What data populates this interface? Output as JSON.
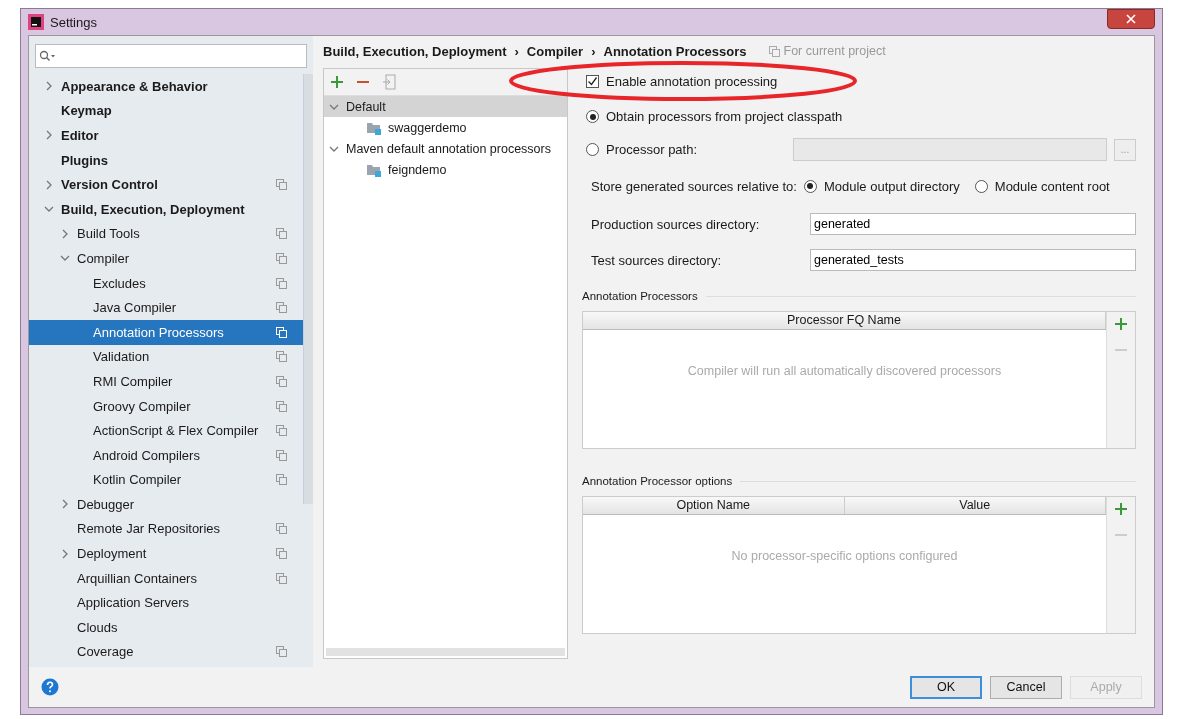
{
  "window": {
    "title": "Settings"
  },
  "sidebar": {
    "items": [
      {
        "label": "Appearance & Behavior",
        "kind": "collapsed",
        "project_icon": false,
        "selected": false
      },
      {
        "label": "Keymap",
        "kind": "leaf",
        "project_icon": false,
        "selected": false
      },
      {
        "label": "Editor",
        "kind": "collapsed",
        "project_icon": false,
        "selected": false
      },
      {
        "label": "Plugins",
        "kind": "leaf",
        "project_icon": false,
        "selected": false
      },
      {
        "label": "Version Control",
        "kind": "collapsed",
        "project_icon": true,
        "selected": false
      },
      {
        "label": "Build, Execution, Deployment",
        "kind": "expanded",
        "project_icon": false,
        "selected": false,
        "children": [
          {
            "label": "Build Tools",
            "kind": "collapsed",
            "project_icon": true,
            "selected": false
          },
          {
            "label": "Compiler",
            "kind": "expanded",
            "project_icon": true,
            "selected": false,
            "children": [
              {
                "label": "Excludes",
                "kind": "leaf",
                "project_icon": true,
                "selected": false
              },
              {
                "label": "Java Compiler",
                "kind": "leaf",
                "project_icon": true,
                "selected": false
              },
              {
                "label": "Annotation Processors",
                "kind": "leaf",
                "project_icon": true,
                "selected": true
              },
              {
                "label": "Validation",
                "kind": "leaf",
                "project_icon": true,
                "selected": false
              },
              {
                "label": "RMI Compiler",
                "kind": "leaf",
                "project_icon": true,
                "selected": false
              },
              {
                "label": "Groovy Compiler",
                "kind": "leaf",
                "project_icon": true,
                "selected": false
              },
              {
                "label": "ActionScript & Flex Compiler",
                "kind": "leaf",
                "project_icon": true,
                "selected": false
              },
              {
                "label": "Android Compilers",
                "kind": "leaf",
                "project_icon": true,
                "selected": false
              },
              {
                "label": "Kotlin Compiler",
                "kind": "leaf",
                "project_icon": true,
                "selected": false
              }
            ]
          },
          {
            "label": "Debugger",
            "kind": "collapsed",
            "project_icon": false,
            "selected": false
          },
          {
            "label": "Remote Jar Repositories",
            "kind": "leaf",
            "project_icon": true,
            "selected": false
          },
          {
            "label": "Deployment",
            "kind": "collapsed",
            "project_icon": true,
            "selected": false
          },
          {
            "label": "Arquillian Containers",
            "kind": "leaf",
            "project_icon": true,
            "selected": false
          },
          {
            "label": "Application Servers",
            "kind": "leaf",
            "project_icon": false,
            "selected": false
          },
          {
            "label": "Clouds",
            "kind": "leaf",
            "project_icon": false,
            "selected": false
          },
          {
            "label": "Coverage",
            "kind": "leaf",
            "project_icon": true,
            "selected": false
          }
        ]
      }
    ]
  },
  "breadcrumb": {
    "items": [
      "Build, Execution, Deployment",
      "Compiler",
      "Annotation Processors"
    ],
    "separator": "›",
    "scope": "For current project"
  },
  "profiles": {
    "items": [
      {
        "label": "Default",
        "kind": "profile",
        "selected": true,
        "children": [
          {
            "label": "swaggerdemo",
            "kind": "module",
            "selected": false
          }
        ]
      },
      {
        "label": "Maven default annotation processors",
        "kind": "profile",
        "selected": false,
        "children": [
          {
            "label": "feigndemo",
            "kind": "module",
            "selected": false
          }
        ]
      }
    ]
  },
  "options": {
    "enable": {
      "label": "Enable annotation processing",
      "checked": true
    },
    "source": [
      {
        "label": "Obtain processors from project classpath",
        "selected": true
      },
      {
        "label": "Processor path:",
        "selected": false
      }
    ],
    "processor_path": {
      "disabled": true,
      "browse": "..."
    },
    "store": {
      "label": "Store generated sources relative to:",
      "choices": [
        {
          "label": "Module output directory",
          "selected": true
        },
        {
          "label": "Module content root",
          "selected": false
        }
      ]
    },
    "fields": [
      {
        "label": "Production sources directory:",
        "value": "generated"
      },
      {
        "label": "Test sources directory:",
        "value": "generated_tests"
      }
    ]
  },
  "tables": [
    {
      "title": "Annotation Processors",
      "columns": [
        "Processor FQ Name"
      ],
      "empty_text": "Compiler will run all automatically discovered processors"
    },
    {
      "title": "Annotation Processor options",
      "columns": [
        "Option Name",
        "Value"
      ],
      "empty_text": "No processor-specific options configured"
    }
  ],
  "buttons": [
    {
      "label": "OK",
      "kind": "default",
      "disabled": false
    },
    {
      "label": "Cancel",
      "kind": "normal",
      "disabled": false
    },
    {
      "label": "Apply",
      "kind": "normal",
      "disabled": true
    }
  ]
}
